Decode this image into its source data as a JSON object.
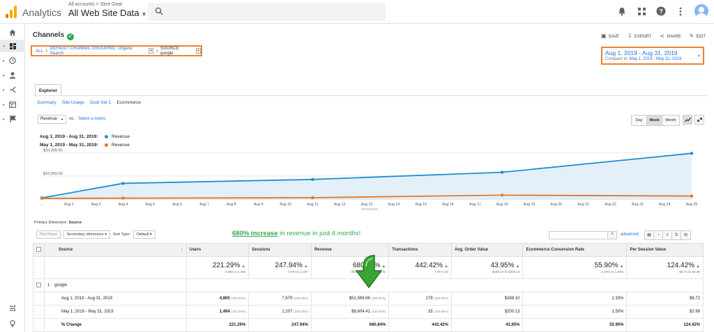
{
  "app": {
    "name": "Analytics",
    "account_crumb": "All accounts > Skre Gear",
    "view_name": "All Web Site Data"
  },
  "page": {
    "title": "Channels",
    "actions": {
      "save": "SAVE",
      "export": "EXPORT",
      "share": "SHARE",
      "edit": "EDIT"
    }
  },
  "breadcrumb": {
    "all": "ALL",
    "grouping": "DEFAULT CHANNEL GROUPING: Organic Search",
    "source": "SOURCE: google"
  },
  "date_range": {
    "main": "Aug 1, 2019 - Aug 31, 2019",
    "compare_label": "Compare to:",
    "compare": "May 1, 2019 - May 31, 2019"
  },
  "tabs": {
    "explorer": "Explorer"
  },
  "subtabs": [
    "Summary",
    "Site Usage",
    "Goal Set 1",
    "Ecommerce"
  ],
  "metric": {
    "selected": "Revenue",
    "vs": "vs.",
    "select": "Select a metric"
  },
  "granularity": [
    "Day",
    "Week",
    "Month"
  ],
  "legend": [
    {
      "period": "Aug 1, 2019 - Aug 31, 2019:",
      "metric": "Revenue"
    },
    {
      "period": "May 1, 2019 - May 31, 2019:",
      "metric": "Revenue"
    }
  ],
  "colors": {
    "current": "#1f8fd1",
    "previous": "#e8761f",
    "area": "#dcecf8",
    "accent_orange": "#f0812d",
    "green": "#34a853"
  },
  "chart_data": {
    "type": "line",
    "x": [
      "...",
      "Aug 2",
      "Aug 3",
      "Aug 4",
      "Aug 5",
      "Aug 6",
      "Aug 7",
      "Aug 8",
      "Aug 9",
      "Aug 10",
      "Aug 11",
      "Aug 12",
      "Aug 13",
      "Aug 14",
      "Aug 15",
      "Aug 16",
      "Aug 17",
      "Aug 18",
      "Aug 19",
      "Aug 20",
      "Aug 21",
      "Aug 22",
      "Aug 23",
      "Aug 24",
      "Aug 25"
    ],
    "yticks": [
      "$20,000.00",
      "$10,000.00"
    ],
    "ylim": [
      0,
      22000
    ],
    "series": [
      {
        "name": "Revenue (Aug 1, 2019 - Aug 31, 2019)",
        "points": [
          [
            0,
            500
          ],
          [
            3,
            6800
          ],
          [
            10,
            8500
          ],
          [
            17,
            11600
          ],
          [
            24,
            19800
          ]
        ]
      },
      {
        "name": "Revenue (May 1, 2019 - May 31, 2019)",
        "points": [
          [
            0,
            300
          ],
          [
            3,
            400
          ],
          [
            10,
            600
          ],
          [
            17,
            1700
          ],
          [
            24,
            1300
          ]
        ]
      }
    ]
  },
  "table_area": {
    "primary_dimension_label": "Primary Dimension:",
    "primary_dimension_value": "Source",
    "plot_rows": "Plot Rows",
    "secondary_dimension": "Secondary dimension",
    "sort_type_label": "Sort Type:",
    "sort_type": "Default",
    "advanced": "advanced",
    "annotation_highlight": "680% increase",
    "annotation_rest": " in revenue in just 4 months!"
  },
  "table": {
    "headers": [
      "Source",
      "Users",
      "Sessions",
      "Revenue",
      "Transactions",
      "Avg. Order Value",
      "Ecommerce Conversion Rate",
      "Per Session Value"
    ],
    "totals": [
      {
        "pct": "221.29%",
        "sub": "4,800 vs 1,494"
      },
      {
        "pct": "247.94%",
        "sub": "7,679 vs 2,207"
      },
      {
        "pct": "680.84%",
        "sub": "$51,569.86 vs $6,604.41"
      },
      {
        "pct": "442.42%",
        "sub": "179 vs 33"
      },
      {
        "pct": "43.95%",
        "sub": "$288.10 vs $200.13"
      },
      {
        "pct": "55.90%",
        "sub": "2.33% vs 1.50%"
      },
      {
        "pct": "124.42%",
        "sub": "$6.72 vs $2.99"
      }
    ],
    "group_row": {
      "index": "1.",
      "name": "google"
    },
    "rows": [
      {
        "label": "Aug 1, 2019 - Aug 31, 2019",
        "cells": [
          [
            "4,800",
            "(100.00%)"
          ],
          [
            "7,679",
            "(100.00%)"
          ],
          [
            "$51,569.86",
            "(100.00%)"
          ],
          [
            "179",
            "(100.00%)"
          ],
          [
            "$288.10",
            ""
          ],
          [
            "2.33%",
            ""
          ],
          [
            "$6.72",
            ""
          ]
        ]
      },
      {
        "label": "May 1, 2019 - May 31, 2019",
        "cells": [
          [
            "1,494",
            "(100.00%)"
          ],
          [
            "2,207",
            "(100.00%)"
          ],
          [
            "$6,604.41",
            "(100.00%)"
          ],
          [
            "33",
            "(100.00%)"
          ],
          [
            "$200.13",
            ""
          ],
          [
            "1.50%",
            ""
          ],
          [
            "$2.99",
            ""
          ]
        ]
      },
      {
        "label": "% Change",
        "cells": [
          [
            "221.29%",
            ""
          ],
          [
            "247.94%",
            ""
          ],
          [
            "680.84%",
            ""
          ],
          [
            "442.42%",
            ""
          ],
          [
            "43.95%",
            ""
          ],
          [
            "55.90%",
            ""
          ],
          [
            "124.42%",
            ""
          ]
        ]
      }
    ]
  }
}
